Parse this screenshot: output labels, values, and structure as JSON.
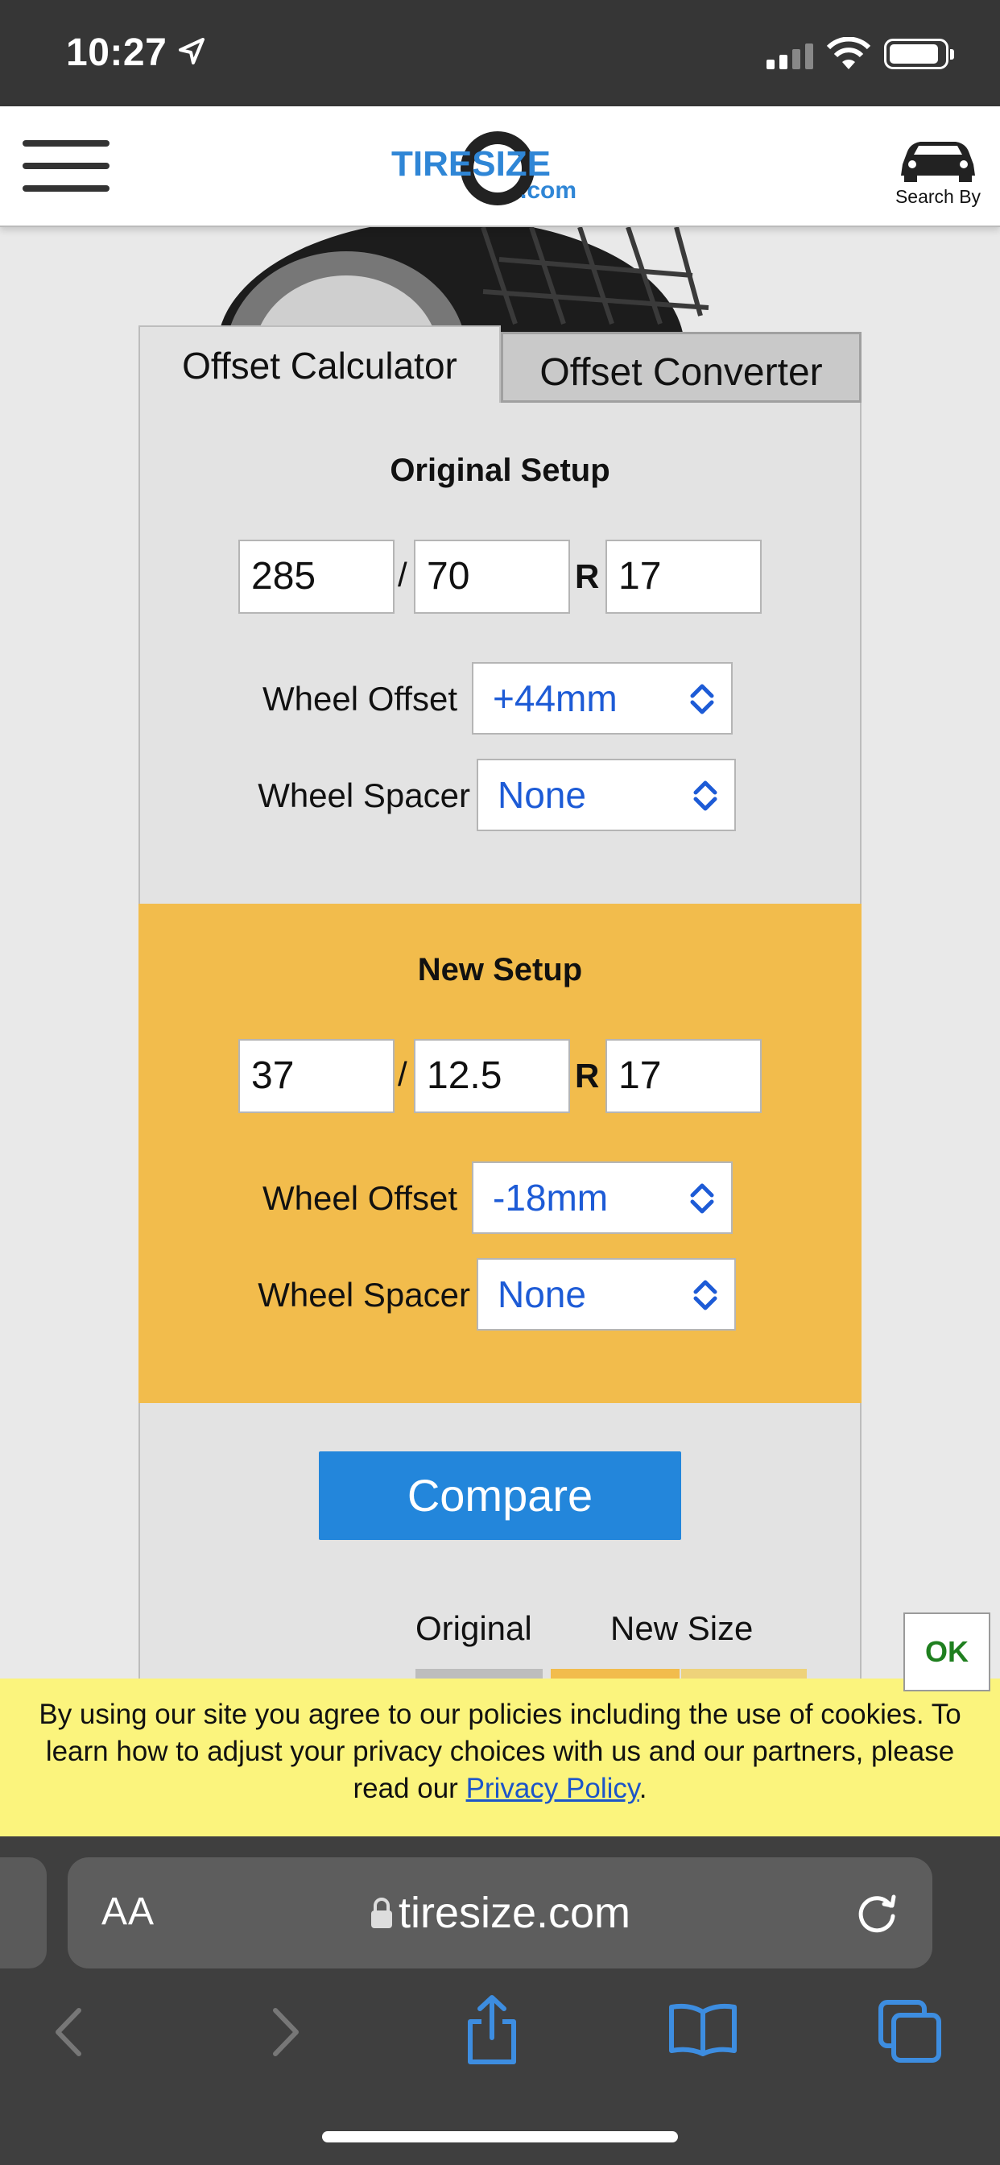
{
  "status_bar": {
    "time": "10:27"
  },
  "header": {
    "logo_text_main": "TIRESIZE",
    "logo_text_sub": ".com",
    "search_by_label": "Search By"
  },
  "tabs": [
    {
      "label": "Offset Calculator",
      "active": true
    },
    {
      "label": "Offset Converter",
      "active": false
    }
  ],
  "original": {
    "title": "Original Setup",
    "width": "285",
    "aspect": "70",
    "rim": "17",
    "offset_label": "Wheel Offset",
    "offset_value": "+44mm",
    "spacer_label": "Wheel Spacer",
    "spacer_value": "None"
  },
  "new_setup": {
    "title": "New Setup",
    "width": "37",
    "aspect": "12.5",
    "rim": "17",
    "offset_label": "Wheel Offset",
    "offset_value": "-18mm",
    "spacer_label": "Wheel Spacer",
    "spacer_value": "None"
  },
  "separators": {
    "slash": "/",
    "r": "R"
  },
  "compare_button": "Compare",
  "legend": {
    "original": "Original",
    "new_size": "New Size"
  },
  "ok_button": "OK",
  "cookie": {
    "text": "By using our site you agree to our policies including the use of cookies. To learn how to adjust your privacy choices with us and our partners, please read our ",
    "link": "Privacy Policy",
    "end": "."
  },
  "safari": {
    "aa": "AA",
    "url": "tiresize.com"
  },
  "colors": {
    "new_setup_bg": "#f2bc4c",
    "compare_bg": "#2386db",
    "select_text": "#1d5bd6",
    "cookie_bg": "#fbf47d",
    "ok_text": "#1f7f1f"
  }
}
